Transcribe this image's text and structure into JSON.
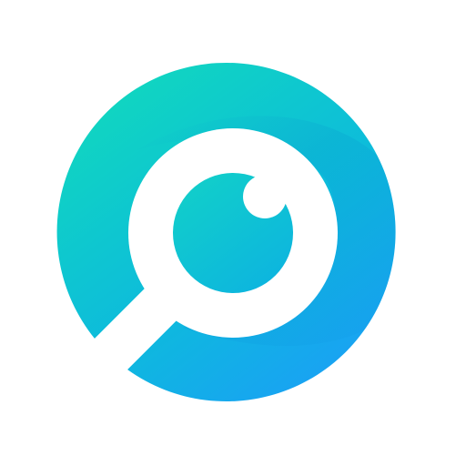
{
  "app_icon": {
    "name": "eye-magnifier-icon",
    "colors": {
      "background": "#ffffff",
      "gradient_start": "#10D6C0",
      "gradient_mid": "#0DBBDC",
      "gradient_end": "#1AA0F5",
      "shade": "#0A9FCF",
      "glyph": "#ffffff"
    }
  }
}
